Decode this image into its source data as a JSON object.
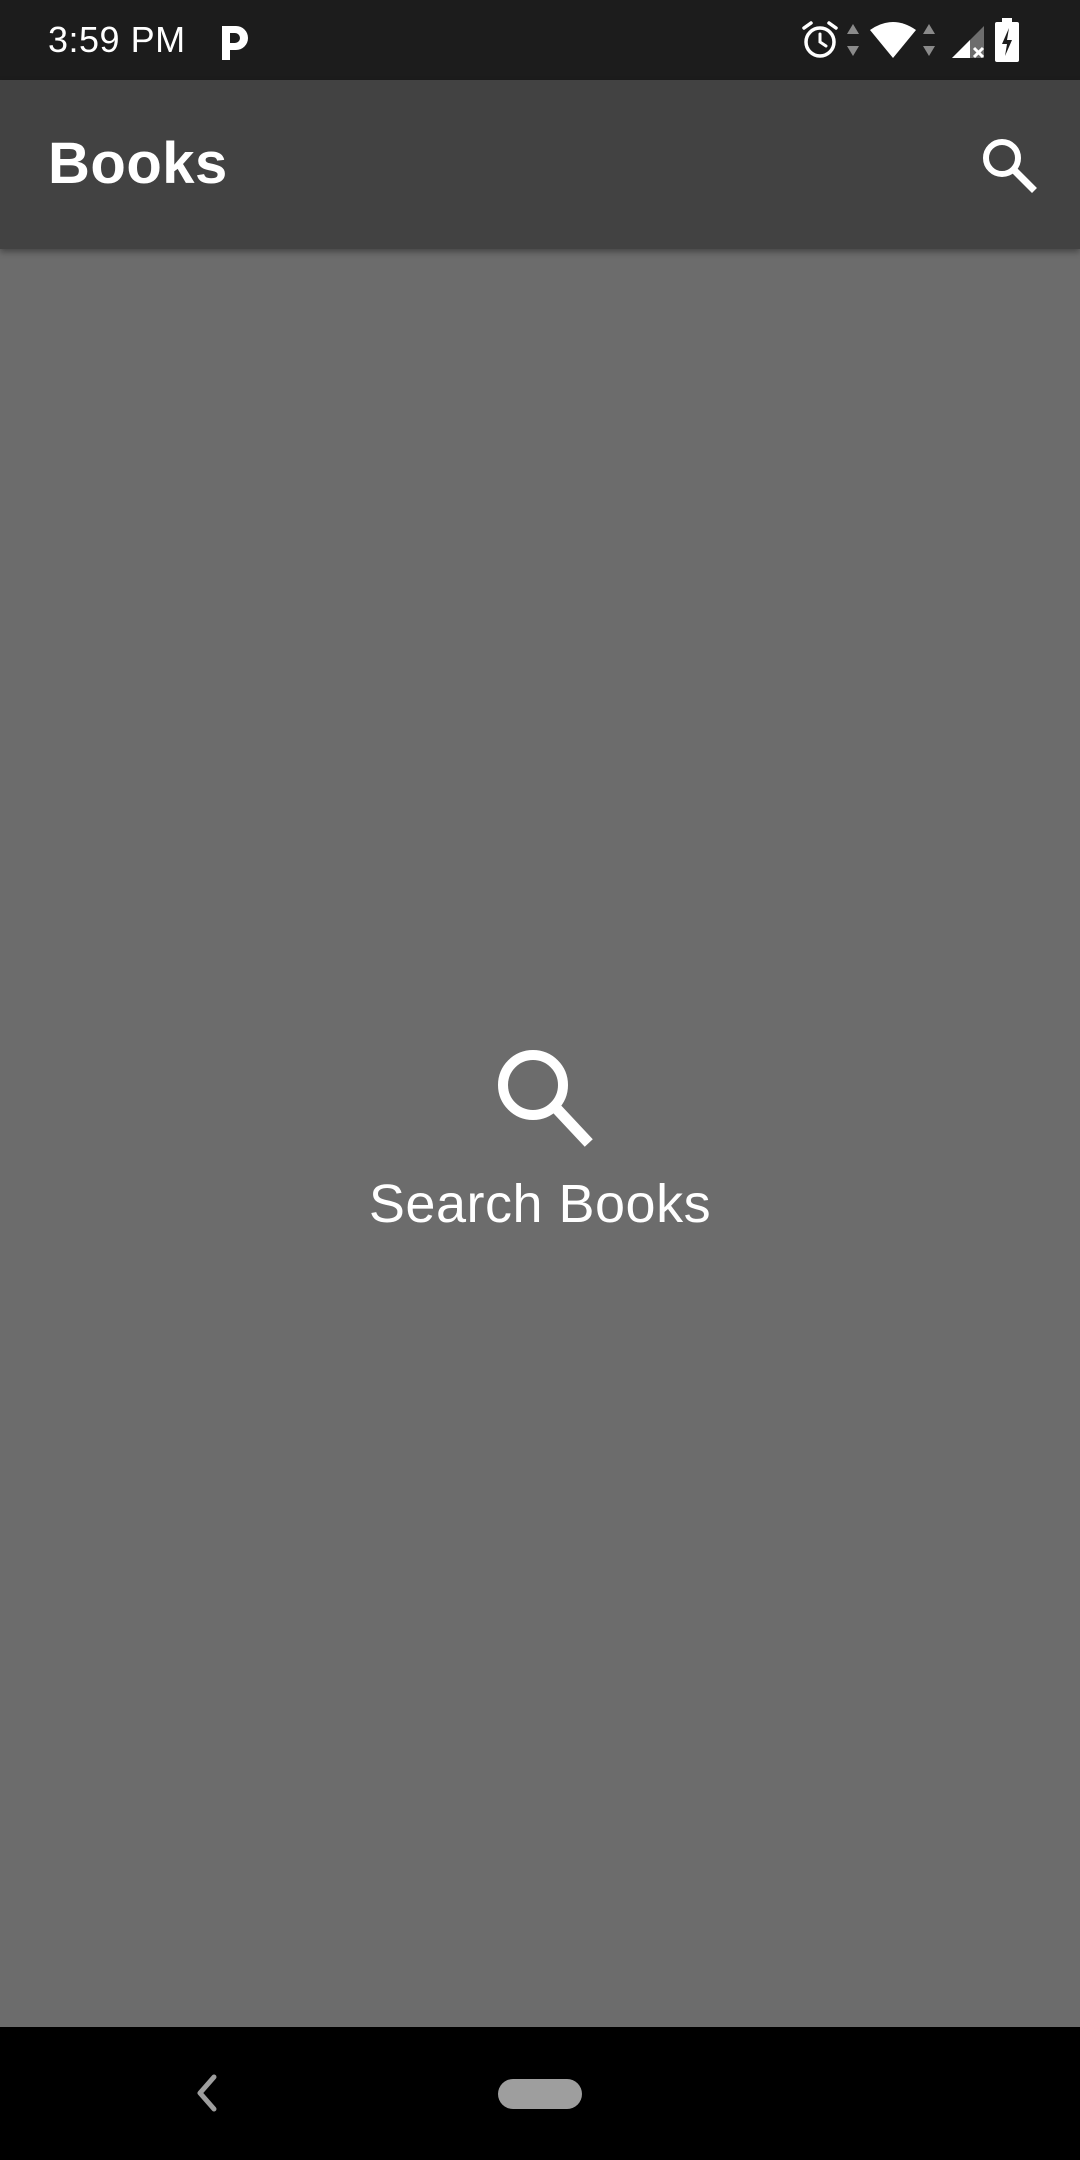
{
  "status_bar": {
    "time": "3:59 PM",
    "icons": [
      "parking-app-icon",
      "alarm-icon",
      "wifi-icon",
      "signal-icon",
      "battery-icon"
    ]
  },
  "app_bar": {
    "title": "Books",
    "search_icon": "search-icon"
  },
  "empty_state": {
    "icon": "search-icon",
    "label": "Search Books"
  },
  "nav_bar": {
    "back_icon": "back-icon",
    "home_icon": "home-pill-icon"
  },
  "colors": {
    "status_bar_bg": "#1c1c1c",
    "app_bar_bg": "#424242",
    "content_bg": "#6c6c6c",
    "nav_bar_bg": "#000000",
    "text": "#ffffff"
  }
}
